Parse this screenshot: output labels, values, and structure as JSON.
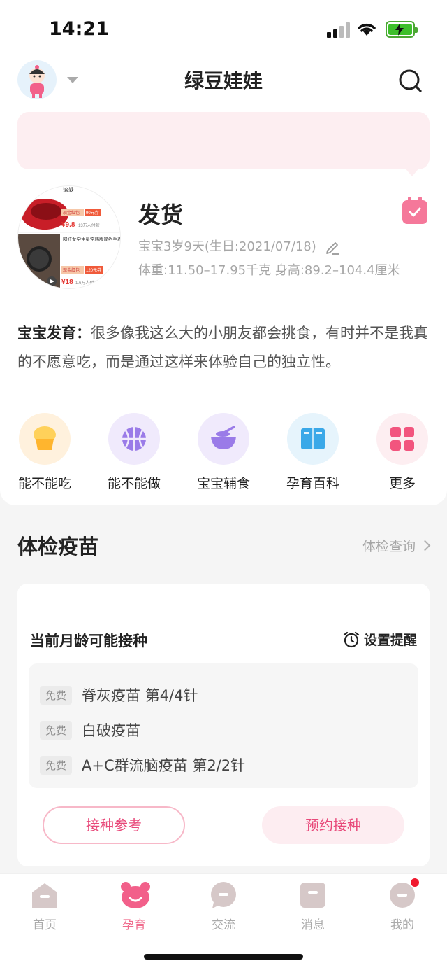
{
  "status": {
    "time": "14:21"
  },
  "header": {
    "title": "绿豆娃娃"
  },
  "profile": {
    "name": "发货",
    "age": "宝宝3岁9天(生日:2021/07/18)",
    "measure": "体重:11.50–17.95千克 身高:89.2–104.4厘米"
  },
  "photo_ads": {
    "top_title": "滚轶",
    "top_tag": "现金红包",
    "top_tag2": "90元券",
    "top_price": "¥9.8",
    "top_sold": "13万人付款",
    "bottom_title": "网红女学生星空韩版简约手表",
    "bottom_tag": "现金红包",
    "bottom_tag2": "120元券",
    "bottom_price": "¥18",
    "bottom_sold": "1.6万人付"
  },
  "development": {
    "label": "宝宝发育：",
    "text": "很多像我这么大的小朋友都会挑食，有时并不是我真的不愿意吃，而是通过这样来体验自己的独立性。"
  },
  "quick_menu": [
    {
      "label": "能不能吃",
      "icon": "muffin-icon",
      "color": "#fff1dd"
    },
    {
      "label": "能不能做",
      "icon": "basketball-icon",
      "color": "#f0eafc"
    },
    {
      "label": "宝宝辅食",
      "icon": "bowl-icon",
      "color": "#f0eafc"
    },
    {
      "label": "孕育百科",
      "icon": "book-icon",
      "color": "#e6f4fc"
    },
    {
      "label": "更多",
      "icon": "grid-icon",
      "color": "#fdeef1"
    }
  ],
  "vaccine_section": {
    "title": "体检疫苗",
    "link": "体检查询",
    "card_title": "当前月龄可能接种",
    "reminder": "设置提醒",
    "items": [
      {
        "tag": "免费",
        "name": "脊灰疫苗 第4/4针"
      },
      {
        "tag": "免费",
        "name": "白破疫苗"
      },
      {
        "tag": "免费",
        "name": "A+C群流脑疫苗 第2/2针"
      }
    ],
    "btn_reference": "接种参考",
    "btn_book": "预约接种"
  },
  "tabs": [
    {
      "label": "首页",
      "icon": "home-icon"
    },
    {
      "label": "孕育",
      "icon": "bear-icon"
    },
    {
      "label": "交流",
      "icon": "chat-icon"
    },
    {
      "label": "消息",
      "icon": "message-icon"
    },
    {
      "label": "我的",
      "icon": "profile-icon"
    }
  ]
}
